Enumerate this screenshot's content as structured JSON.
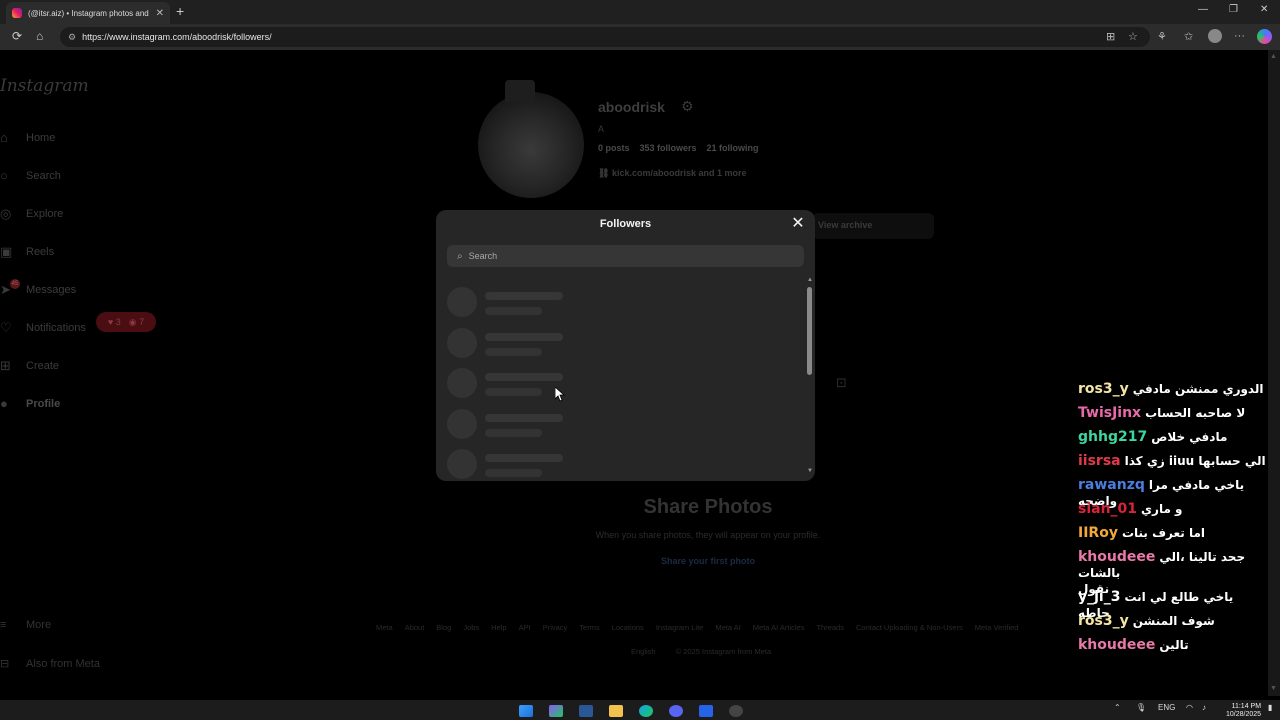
{
  "browser": {
    "tab_title": "(@itsr.aiz) • Instagram photos and",
    "new_tab": "+",
    "tab_close": "✕",
    "url": "https://www.instagram.com/aboodrisk/followers/",
    "win_minimize": "—",
    "win_restore": "❐",
    "win_close": "✕"
  },
  "instagram": {
    "logo": "Instagram",
    "nav": {
      "home": "Home",
      "search": "Search",
      "explore": "Explore",
      "reels": "Reels",
      "messages": "Messages",
      "notifications": "Notifications",
      "create": "Create",
      "profile": "Profile",
      "more": "More",
      "also_from_meta": "Also from Meta"
    },
    "messages_badge": "45",
    "notif_likes": "3",
    "notif_follows": "7",
    "profile": {
      "username": "aboodrisk",
      "bio": "A",
      "posts": "0 posts",
      "followers": "353 followers",
      "following": "21 following",
      "link": "kick.com/aboodrisk and 1 more",
      "archive_button": "View archive"
    },
    "empty_state": {
      "title": "Share Photos",
      "subtitle": "When you share photos, they will appear on your profile.",
      "link": "Share your first photo"
    },
    "footer": {
      "links": [
        "Meta",
        "About",
        "Blog",
        "Jobs",
        "Help",
        "API",
        "Privacy",
        "Terms",
        "Locations",
        "Instagram Lite",
        "Meta AI",
        "Meta AI Articles",
        "Threads",
        "Contact Uploading & Non-Users",
        "Meta Verified"
      ],
      "language": "English",
      "copyright": "© 2025 Instagram from Meta"
    }
  },
  "modal": {
    "title": "Followers",
    "close_icon": "✕",
    "search_placeholder": "Search",
    "skeleton_rows": 5
  },
  "chat": [
    {
      "user": "ros3_y",
      "text": "الدوري ممنشن مادفي",
      "color": "#f4e4a6"
    },
    {
      "user": "TwisJinx",
      "text": "لا صاحبه الحساب",
      "color": "#e86aa8"
    },
    {
      "user": "ghhg217",
      "text": "مادفي خلاص",
      "color": "#3ed6a0"
    },
    {
      "user": "iisrsa",
      "text": "زي كذا iiuu الي حسابها",
      "color": "#e03a4a"
    },
    {
      "user": "rawanzq",
      "text": "ياخي مادفي مرا واضحه",
      "color": "#4a7fe0"
    },
    {
      "user": "sian_01",
      "text": "و ماري",
      "color": "#d8233a"
    },
    {
      "user": "IIRoy",
      "text": "اما تعرف بنات",
      "color": "#f2a93a"
    },
    {
      "user": "khoudeee",
      "text": "جحد تالينا ،الي بالشات",
      "text2": "نقول",
      "color": "#e879a8"
    },
    {
      "user": "y_ji_3",
      "text": "ياخي طالع لي انت حاطه",
      "color": "#ffffff"
    },
    {
      "user": "ros3_y",
      "text": "شوف المنشن",
      "color": "#f4e4a6"
    },
    {
      "user": "khoudeee",
      "text": "تالين",
      "color": "#e879a8"
    }
  ],
  "taskbar": {
    "language": "ENG",
    "time": "11:14 PM",
    "date": "10/28/2025"
  }
}
